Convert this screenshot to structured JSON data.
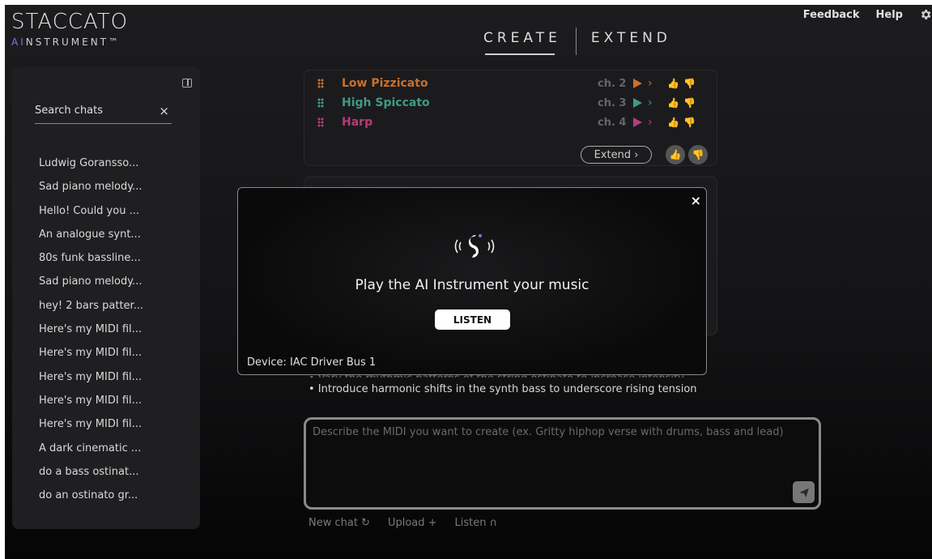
{
  "brand": {
    "name": "STACCATO",
    "sub_ai": "AI",
    "sub_rest": "NSTRUMENT™"
  },
  "nav": {
    "tabs": [
      {
        "label": "CREATE",
        "active": true
      },
      {
        "label": "EXTEND",
        "active": false
      }
    ]
  },
  "header_links": {
    "feedback": "Feedback",
    "help": "Help"
  },
  "sidebar": {
    "search_placeholder": "Search chats",
    "clear": "×",
    "chats": [
      "Ludwig Goransso...",
      "Sad piano melody...",
      "Hello! Could you ...",
      "An analogue synt...",
      "80s funk bassline...",
      "Sad piano melody...",
      "hey! 2 bars patter...",
      "Here's my MIDI fil...",
      "Here's my MIDI fil...",
      "Here's my MIDI fil...",
      "Here's my MIDI fil...",
      "Here's my MIDI fil...",
      "A dark cinematic ...",
      "do a bass ostinat...",
      "do an ostinato gr..."
    ]
  },
  "tracks": [
    {
      "name": "Low Pizzicato",
      "channel": "ch. 2",
      "color": "#c8702d"
    },
    {
      "name": "High Spiccato",
      "channel": "ch. 3",
      "color": "#3f9a86"
    },
    {
      "name": "Harp",
      "channel": "ch. 4",
      "color": "#b43c7c"
    }
  ],
  "card": {
    "extend_label": "Extend ›"
  },
  "bullets": {
    "partial": "• Vary the rhythmic patterns of the string ostinato to increase intensity",
    "last": "• Introduce harmonic shifts in the synth bass to underscore rising tension"
  },
  "prompt": {
    "placeholder": "Describe the MIDI you want to create (ex. Gritty hiphop verse with drums, bass and lead)"
  },
  "actions": {
    "new_chat": "New chat ↻",
    "upload": "Upload +",
    "listen": "Listen ∩"
  },
  "modal": {
    "title": "Play the AI Instrument your music",
    "listen_label": "LISTEN",
    "device": "Device: IAC Driver Bus 1",
    "close": "×"
  },
  "colors": {
    "accent_purple": "#9a6cd8"
  }
}
